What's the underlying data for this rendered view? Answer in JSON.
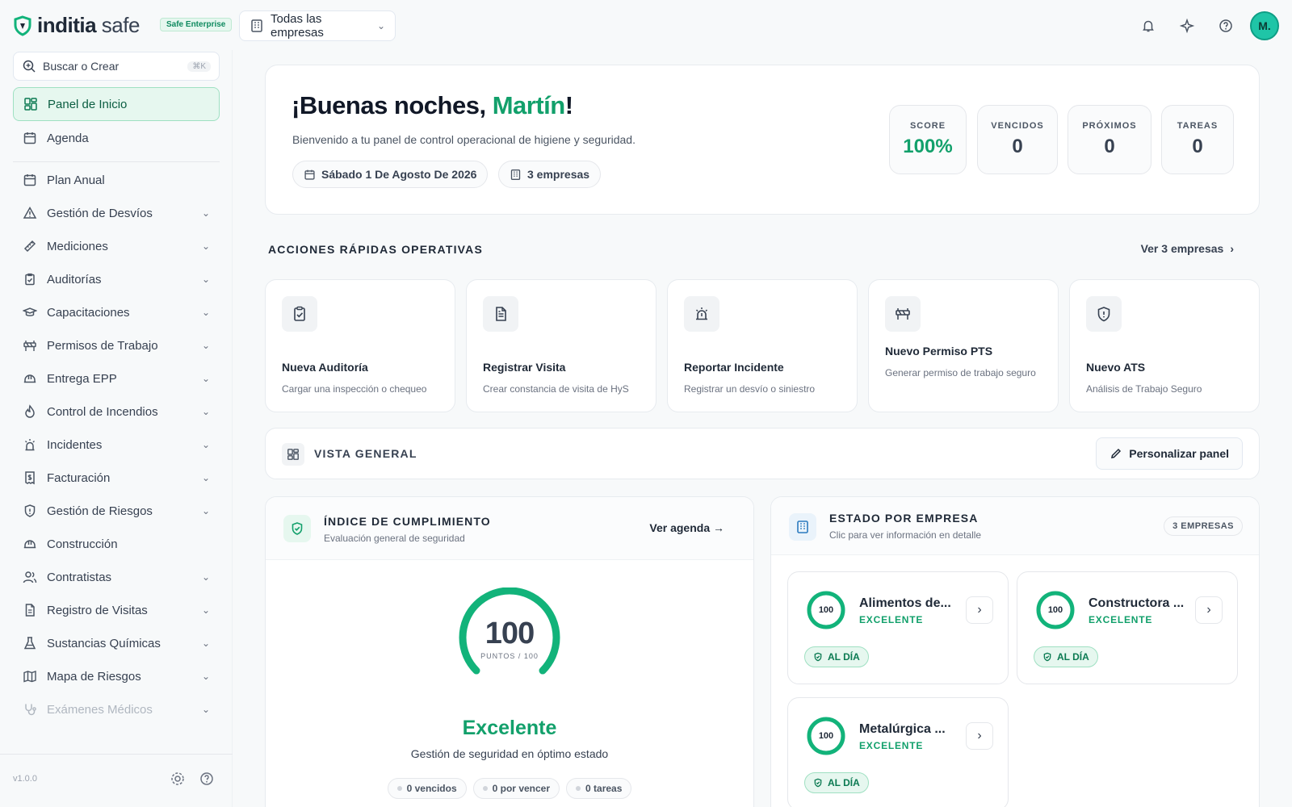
{
  "brand": {
    "name_bold": "inditia",
    "name_light": " safe",
    "plan": "Safe Enterprise",
    "accent_color": "#12a06b"
  },
  "header": {
    "company_selector": "Todas las empresas",
    "avatar_initials": "M."
  },
  "sidebar": {
    "search_placeholder": "Buscar o Crear",
    "search_shortcut": "⌘K",
    "home": "Panel de Inicio",
    "agenda": "Agenda",
    "items": [
      {
        "label": "Plan Anual",
        "icon": "calendar-icon",
        "expandable": false
      },
      {
        "label": "Gestión de Desvíos",
        "icon": "warning-triangle-icon",
        "expandable": true
      },
      {
        "label": "Mediciones",
        "icon": "ruler-icon",
        "expandable": true
      },
      {
        "label": "Auditorías",
        "icon": "clipboard-check-icon",
        "expandable": true
      },
      {
        "label": "Capacitaciones",
        "icon": "graduation-cap-icon",
        "expandable": true
      },
      {
        "label": "Permisos de Trabajo",
        "icon": "barrier-icon",
        "expandable": true
      },
      {
        "label": "Entrega EPP",
        "icon": "hard-hat-icon",
        "expandable": true
      },
      {
        "label": "Control de Incendios",
        "icon": "flame-icon",
        "expandable": true
      },
      {
        "label": "Incidentes",
        "icon": "siren-icon",
        "expandable": true
      },
      {
        "label": "Facturación",
        "icon": "receipt-icon",
        "expandable": true
      },
      {
        "label": "Gestión de Riesgos",
        "icon": "shield-alert-icon",
        "expandable": true
      },
      {
        "label": "Construcción",
        "icon": "hard-hat-icon",
        "expandable": false
      },
      {
        "label": "Contratistas",
        "icon": "users-icon",
        "expandable": true
      },
      {
        "label": "Registro de Visitas",
        "icon": "document-icon",
        "expandable": true
      },
      {
        "label": "Sustancias Químicas",
        "icon": "flask-icon",
        "expandable": true
      },
      {
        "label": "Mapa de Riesgos",
        "icon": "map-icon",
        "expandable": true
      },
      {
        "label": "Exámenes Médicos",
        "icon": "stethoscope-icon",
        "expandable": true
      }
    ],
    "version": "v1.0.0"
  },
  "welcome": {
    "greeting": "¡Buenas noches, ",
    "name": "Martín",
    "exclaim": "!",
    "subtitle": "Bienvenido a tu panel de control operacional de higiene y seguridad.",
    "date": "Sábado 1 De Agosto De 2026",
    "companies": "3 empresas",
    "stats": [
      {
        "label": "SCORE",
        "value": "100%"
      },
      {
        "label": "VENCIDOS",
        "value": "0"
      },
      {
        "label": "PRÓXIMOS",
        "value": "0"
      },
      {
        "label": "TAREAS",
        "value": "0"
      }
    ]
  },
  "quick_actions": {
    "title": "ACCIONES RÁPIDAS OPERATIVAS",
    "link": "Ver 3 empresas",
    "items": [
      {
        "title": "Nueva Auditoría",
        "desc": "Cargar una inspección o chequeo",
        "icon": "clipboard-check-icon"
      },
      {
        "title": "Registrar Visita",
        "desc": "Crear constancia de visita de HyS",
        "icon": "document-icon"
      },
      {
        "title": "Reportar Incidente",
        "desc": "Registrar un desvío o siniestro",
        "icon": "siren-icon"
      },
      {
        "title": "Nuevo Permiso PTS",
        "desc": "Generar permiso de trabajo seguro",
        "icon": "barrier-icon"
      },
      {
        "title": "Nuevo ATS",
        "desc": "Análisis de Trabajo Seguro",
        "icon": "shield-alert-icon"
      }
    ]
  },
  "overview": {
    "title": "VISTA GENERAL",
    "customize": "Personalizar panel"
  },
  "compliance": {
    "title": "ÍNDICE DE CUMPLIMIENTO",
    "subtitle": "Evaluación general de seguridad",
    "link": "Ver agenda →",
    "score": "100",
    "score_fraction": 1.0,
    "score_unit": "PUNTOS / 100",
    "grade": "Excelente",
    "description": "Gestión de seguridad en óptimo estado",
    "chips": [
      "0 vencidos",
      "0 por vencer",
      "0 tareas"
    ]
  },
  "company_status": {
    "title": "ESTADO POR EMPRESA",
    "subtitle": "Clic para ver información en detalle",
    "count": "3 EMPRESAS",
    "companies": [
      {
        "name": "Alimentos de...",
        "score": "100",
        "grade": "EXCELENTE",
        "status": "AL DÍA"
      },
      {
        "name": "Constructora ...",
        "score": "100",
        "grade": "EXCELENTE",
        "status": "AL DÍA"
      },
      {
        "name": "Metalúrgica ...",
        "score": "100",
        "grade": "EXCELENTE",
        "status": "AL DÍA"
      }
    ]
  }
}
